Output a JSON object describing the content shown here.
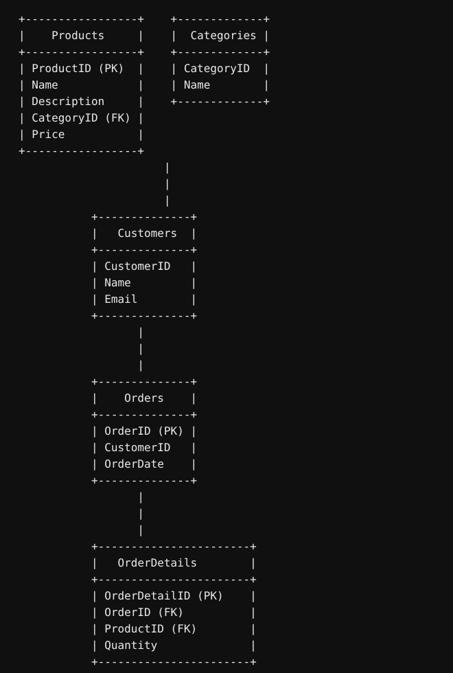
{
  "diagram": {
    "kind": "ascii-er-diagram",
    "background_color": "#101010",
    "text_color": "#e9e9e9",
    "entities": [
      {
        "name": "Products",
        "title_row": "|    Products     |",
        "fields": [
          "ProductID (PK)",
          "Name",
          "Description",
          "CategoryID (FK)",
          "Price"
        ]
      },
      {
        "name": "Categories",
        "title_row": "|  Categories |",
        "fields": [
          "CategoryID",
          "Name"
        ]
      },
      {
        "name": "Customers",
        "title_row": "|   Customers  |",
        "fields": [
          "CustomerID",
          "Name",
          "Email"
        ]
      },
      {
        "name": "Orders",
        "title_row": "|    Orders    |",
        "fields": [
          "OrderID (PK)",
          "CustomerID",
          "OrderDate"
        ]
      },
      {
        "name": "OrderDetails",
        "title_row": "|   OrderDetails       |",
        "fields": [
          "OrderDetailID (PK)",
          "OrderID (FK)",
          "ProductID (FK)",
          "Quantity"
        ]
      }
    ],
    "connectors": [
      {
        "from": "Products",
        "to": "Customers",
        "glyph": "|"
      },
      {
        "from": "Customers",
        "to": "Orders",
        "glyph": "|"
      },
      {
        "from": "Orders",
        "to": "OrderDetails",
        "glyph": "|"
      }
    ],
    "art": "+-----------------+    +-------------+\n|    Products     |    |  Categories |\n+-----------------+    +-------------+\n| ProductID (PK)  |    | CategoryID  |\n| Name            |    | Name        |\n| Description     |    +-------------+\n| CategoryID (FK) |\n| Price           |\n+-----------------+\n                      |\n                      |\n                      |\n           +--------------+\n           |   Customers  |\n           +--------------+\n           | CustomerID   |\n           | Name         |\n           | Email        |\n           +--------------+\n                  |\n                  |\n                  |\n           +--------------+\n           |    Orders    |\n           +--------------+\n           | OrderID (PK) |\n           | CustomerID   |\n           | OrderDate    |\n           +--------------+\n                  |\n                  |\n                  |\n           +-----------------------+\n           |   OrderDetails        |\n           +-----------------------+\n           | OrderDetailID (PK)    |\n           | OrderID (FK)          |\n           | ProductID (FK)        |\n           | Quantity              |\n           +-----------------------+"
  }
}
